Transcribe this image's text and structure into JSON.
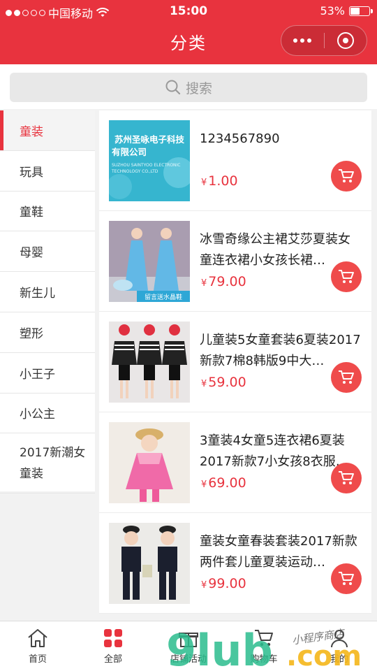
{
  "status": {
    "carrier": "中国移动",
    "time": "15:00",
    "battery": "53%",
    "battery_level": 0.53,
    "signal_filled": 2,
    "signal_total": 5
  },
  "nav": {
    "title": "分类"
  },
  "search": {
    "placeholder": "搜索"
  },
  "categories": [
    {
      "label": "童装",
      "active": true
    },
    {
      "label": "玩具"
    },
    {
      "label": "童鞋"
    },
    {
      "label": "母婴"
    },
    {
      "label": "新生儿"
    },
    {
      "label": "塑形"
    },
    {
      "label": "小王子"
    },
    {
      "label": "小公主"
    },
    {
      "label": "2017新潮女童装"
    }
  ],
  "products": [
    {
      "name": "1234567890",
      "currency": "¥",
      "price": "1.00",
      "thumb_text": "苏州圣咏电子科技有限公司",
      "thumb_subtext": "SUZHOU SAINTYOO ELECTRONIC TECHNOLOGY CO.,LTD"
    },
    {
      "name": "冰雪奇缘公主裙艾莎夏装女童连衣裙小女孩长裙…",
      "currency": "¥",
      "price": "79.00",
      "thumb_text": "留言送水晶鞋"
    },
    {
      "name": "儿童装5女童套装6夏装2017新款7棉8韩版9中大…",
      "currency": "¥",
      "price": "59.00"
    },
    {
      "name": "3童装4女童5连衣裙6夏装2017新款7小女孩8衣服…",
      "currency": "¥",
      "price": "69.00"
    },
    {
      "name": "童装女童春装套装2017新款两件套儿童夏装运动…",
      "currency": "¥",
      "price": "99.00"
    }
  ],
  "tabs": [
    {
      "label": "首页",
      "icon": "home-icon"
    },
    {
      "label": "全部",
      "icon": "grid-icon"
    },
    {
      "label": "店铺活动",
      "icon": "gift-icon"
    },
    {
      "label": "购物车",
      "icon": "cart-icon"
    },
    {
      "label": "我的",
      "icon": "user-icon"
    }
  ],
  "watermark": {
    "text": "9lub.com",
    "tagline": "小程序商店"
  },
  "colors": {
    "brand": "#e8333e",
    "cart_button": "#ef4b4b"
  }
}
